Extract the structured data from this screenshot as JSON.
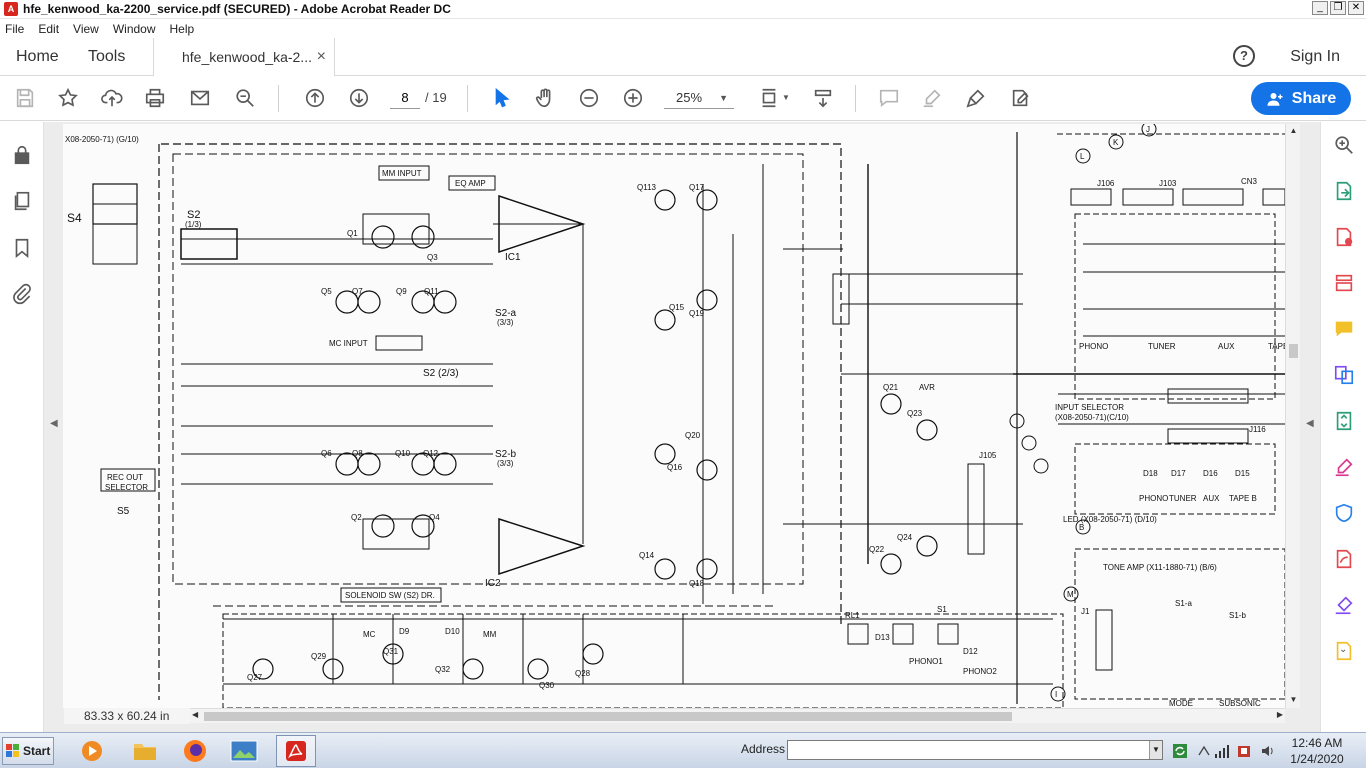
{
  "window": {
    "title": "hfe_kenwood_ka-2200_service.pdf (SECURED) - Adobe Acrobat Reader DC",
    "app_icon": "acrobat-icon",
    "buttons": [
      "minimize",
      "restore",
      "close"
    ]
  },
  "menu": [
    "File",
    "Edit",
    "View",
    "Window",
    "Help"
  ],
  "tabs": {
    "home": "Home",
    "tools": "Tools",
    "document": "hfe_kenwood_ka-2...",
    "close_glyph": "×",
    "help_glyph": "?",
    "signin": "Sign In"
  },
  "toolbar": {
    "page_current": "8",
    "page_total": "/ 19",
    "zoom": "25%",
    "share_label": "Share",
    "accent": "#1473e6",
    "icons": [
      "save-icon",
      "bookmark-star-icon",
      "upload-icon",
      "print-icon",
      "email-icon",
      "search-zoom-icon",
      "page-up-icon",
      "page-down-icon",
      "select-cursor-icon",
      "hand-icon",
      "zoom-out-icon",
      "zoom-in-icon",
      "page-fit-icon",
      "scroll-mode-icon",
      "comment-icon",
      "highlight-icon",
      "sign-icon",
      "fill-sign-icon"
    ]
  },
  "left_panel": {
    "icons": [
      "lock-icon",
      "pages-icon",
      "bookmark-icon",
      "attachment-icon"
    ]
  },
  "right_panel": {
    "icons": [
      "search-zoom-icon",
      "export-pdf-icon",
      "create-pdf-icon",
      "organize-pages-icon",
      "comment-icon",
      "combine-files-icon",
      "compress-icon",
      "fill-sign-icon",
      "protect-icon",
      "more-tools-icon",
      "sign-icon",
      "send-icon"
    ]
  },
  "status": {
    "dimensions": "83.33 x 60.24 in"
  },
  "schematic": {
    "labels": [
      {
        "t": "X08-2050-71) (G/10)"
      },
      {
        "t": "MM INPUT"
      },
      {
        "t": "EQ AMP"
      },
      {
        "t": "S2"
      },
      {
        "t": "(1/3)"
      },
      {
        "t": "S4"
      },
      {
        "t": "Q1"
      },
      {
        "t": "Q3"
      },
      {
        "t": "Q5"
      },
      {
        "t": "Q7"
      },
      {
        "t": "Q9"
      },
      {
        "t": "Q11"
      },
      {
        "t": "IC1"
      },
      {
        "t": "MC INPUT"
      },
      {
        "t": "S2 (2/3)"
      },
      {
        "t": "S2-a"
      },
      {
        "t": "(3/3)"
      },
      {
        "t": "S2-b"
      },
      {
        "t": "(3/3)"
      },
      {
        "t": "Q113"
      },
      {
        "t": "Q17"
      },
      {
        "t": "Q15"
      },
      {
        "t": "Q19"
      },
      {
        "t": "Q21"
      },
      {
        "t": "AVR"
      },
      {
        "t": "Q23"
      },
      {
        "t": "INPUT SELECTOR"
      },
      {
        "t": "(X08-2050-71)(C/10)"
      },
      {
        "t": "PHONO"
      },
      {
        "t": "TUNER"
      },
      {
        "t": "AUX"
      },
      {
        "t": "TAPE"
      },
      {
        "t": "CN3"
      },
      {
        "t": "REC OUT"
      },
      {
        "t": "SELECTOR"
      },
      {
        "t": "S5"
      },
      {
        "t": "Q6"
      },
      {
        "t": "Q8"
      },
      {
        "t": "Q10"
      },
      {
        "t": "Q12"
      },
      {
        "t": "Q2"
      },
      {
        "t": "Q4"
      },
      {
        "t": "Q16"
      },
      {
        "t": "Q18"
      },
      {
        "t": "Q14"
      },
      {
        "t": "Q20"
      },
      {
        "t": "Q22"
      },
      {
        "t": "Q24"
      },
      {
        "t": "IC2"
      },
      {
        "t": "SOLENOID SW (S2) DR."
      },
      {
        "t": "MC"
      },
      {
        "t": "MM"
      },
      {
        "t": "Q27"
      },
      {
        "t": "Q29"
      },
      {
        "t": "Q31"
      },
      {
        "t": "Q32"
      },
      {
        "t": "Q30"
      },
      {
        "t": "Q28"
      },
      {
        "t": "D9"
      },
      {
        "t": "D10"
      },
      {
        "t": "RL1"
      },
      {
        "t": "D13"
      },
      {
        "t": "D12"
      },
      {
        "t": "S1"
      },
      {
        "t": "PHONO1"
      },
      {
        "t": "PHONO2"
      },
      {
        "t": "D18"
      },
      {
        "t": "D17"
      },
      {
        "t": "D16"
      },
      {
        "t": "D15"
      },
      {
        "t": "PHONO"
      },
      {
        "t": "TUNER"
      },
      {
        "t": "AUX"
      },
      {
        "t": "TAPE B"
      },
      {
        "t": "LED (X08-2050-71) (D/10)"
      },
      {
        "t": "TONE AMP (X11-1880-71) (B/6)"
      },
      {
        "t": "S1-a"
      },
      {
        "t": "S1-b"
      },
      {
        "t": "J1"
      },
      {
        "t": "MODE"
      },
      {
        "t": "SUBSONIC"
      },
      {
        "t": "J106"
      },
      {
        "t": "J103"
      },
      {
        "t": "J116"
      },
      {
        "t": "J105"
      },
      {
        "t": "J"
      },
      {
        "t": "K"
      },
      {
        "t": "L"
      },
      {
        "t": "B"
      },
      {
        "t": "M"
      },
      {
        "t": "I"
      }
    ]
  },
  "taskbar": {
    "start_label": "Start",
    "apps": [
      "media-player-icon",
      "file-explorer-icon",
      "firefox-icon",
      "photo-viewer-icon",
      "acrobat-icon"
    ],
    "address_label": "Address",
    "address_value": "",
    "tray_icons": [
      "refresh-icon",
      "network-icon",
      "wifi-bars-icon",
      "security-icon",
      "volume-icon"
    ],
    "time": "12:46 AM",
    "date": "1/24/2020"
  }
}
